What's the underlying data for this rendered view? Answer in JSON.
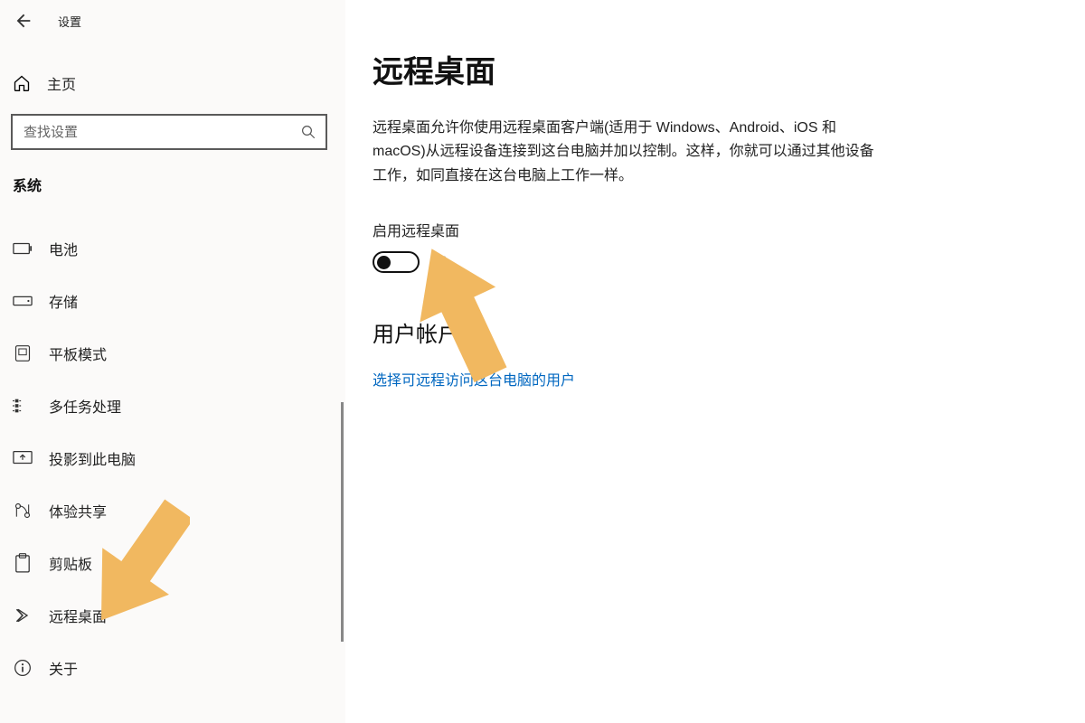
{
  "header": {
    "back_icon": "arrow-left",
    "app_title": "设置"
  },
  "home": {
    "label": "主页"
  },
  "search": {
    "placeholder": "查找设置"
  },
  "category_label": "系统",
  "sidebar": {
    "items": [
      {
        "icon": "battery-icon",
        "label": "电池"
      },
      {
        "icon": "storage-icon",
        "label": "存储"
      },
      {
        "icon": "tablet-icon",
        "label": "平板模式"
      },
      {
        "icon": "multitask-icon",
        "label": "多任务处理"
      },
      {
        "icon": "project-icon",
        "label": "投影到此电脑"
      },
      {
        "icon": "share-icon",
        "label": "体验共享"
      },
      {
        "icon": "clipboard-icon",
        "label": "剪贴板"
      },
      {
        "icon": "remote-icon",
        "label": "远程桌面"
      },
      {
        "icon": "about-icon",
        "label": "关于"
      }
    ]
  },
  "main": {
    "title": "远程桌面",
    "description": "远程桌面允许你使用远程桌面客户端(适用于 Windows、Android、iOS 和 macOS)从远程设备连接到这台电脑并加以控制。这样，你就可以通过其他设备工作，如同直接在这台电脑上工作一样。",
    "toggle_label": "启用远程桌面",
    "toggle_state": "关",
    "section_title": "用户帐户",
    "link_text": "选择可远程访问这台电脑的用户"
  }
}
